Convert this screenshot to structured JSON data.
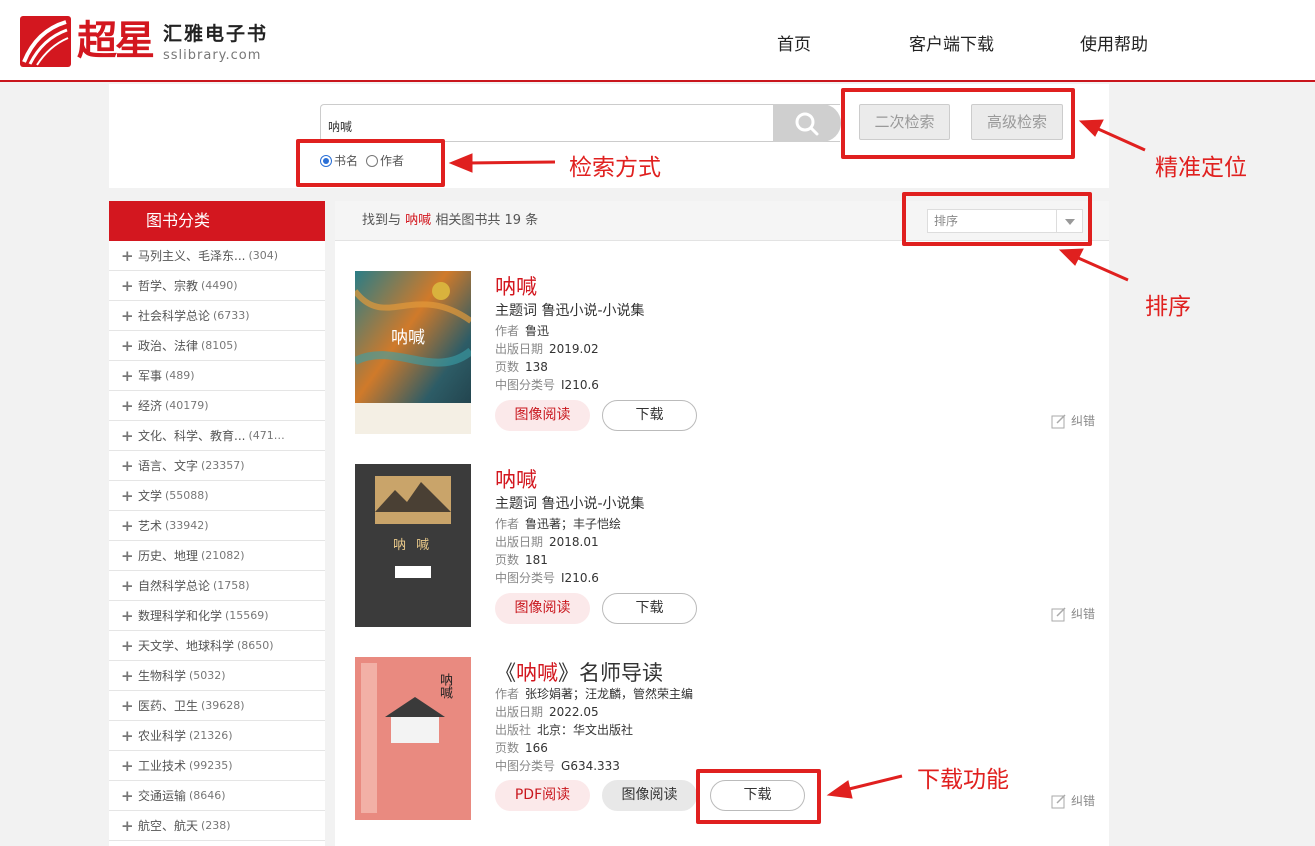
{
  "header": {
    "logo_cn": "超星",
    "logo_title": "汇雅电子书",
    "logo_sub": "sslibrary.com",
    "nav": [
      "首页",
      "客户端下载",
      "使用帮助"
    ]
  },
  "search": {
    "query": "呐喊",
    "secondary_search": "二次检索",
    "advanced_search": "高级检索",
    "modes": [
      {
        "label": "书名",
        "checked": true
      },
      {
        "label": "作者",
        "checked": false
      }
    ]
  },
  "annotations": {
    "search_mode": "检索方式",
    "precise": "精准定位",
    "sort": "排序",
    "download": "下载功能"
  },
  "sidebar": {
    "title": "图书分类",
    "categories": [
      {
        "name": "马列主义、毛泽东...",
        "count": "(304)"
      },
      {
        "name": "哲学、宗教",
        "count": "(4490)"
      },
      {
        "name": "社会科学总论",
        "count": "(6733)"
      },
      {
        "name": "政治、法律",
        "count": "(8105)"
      },
      {
        "name": "军事",
        "count": "(489)"
      },
      {
        "name": "经济",
        "count": "(40179)"
      },
      {
        "name": "文化、科学、教育...",
        "count": "(471…"
      },
      {
        "name": "语言、文字",
        "count": "(23357)"
      },
      {
        "name": "文学",
        "count": "(55088)"
      },
      {
        "name": "艺术",
        "count": "(33942)"
      },
      {
        "name": "历史、地理",
        "count": "(21082)"
      },
      {
        "name": "自然科学总论",
        "count": "(1758)"
      },
      {
        "name": "数理科学和化学",
        "count": "(15569)"
      },
      {
        "name": "天文学、地球科学",
        "count": "(8650)"
      },
      {
        "name": "生物科学",
        "count": "(5032)"
      },
      {
        "name": "医药、卫生",
        "count": "(39628)"
      },
      {
        "name": "农业科学",
        "count": "(21326)"
      },
      {
        "name": "工业技术",
        "count": "(99235)"
      },
      {
        "name": "交通运输",
        "count": "(8646)"
      },
      {
        "name": "航空、航天",
        "count": "(238)"
      }
    ]
  },
  "results": {
    "prefix": "找到与",
    "keyword": "呐喊",
    "suffix": "相关图书共 19 条",
    "sort_placeholder": "排序",
    "fix_label": "纠错",
    "books": [
      {
        "title": "呐喊",
        "subject_label": "主题词",
        "subject": "鲁迅小说-小说集",
        "author_label": "作者",
        "author": "鲁迅",
        "date_label": "出版日期",
        "date": "2019.02",
        "pages_label": "页数",
        "pages": "138",
        "clc_label": "中图分类号",
        "clc": "I210.6",
        "read_btn": "图像阅读",
        "dl_btn": "下载",
        "cover_text": "呐喊"
      },
      {
        "title": "呐喊",
        "subject_label": "主题词",
        "subject": "鲁迅小说-小说集",
        "author_label": "作者",
        "author": "鲁迅著；丰子恺绘",
        "date_label": "出版日期",
        "date": "2018.01",
        "pages_label": "页数",
        "pages": "181",
        "clc_label": "中图分类号",
        "clc": "I210.6",
        "read_btn": "图像阅读",
        "dl_btn": "下载",
        "cover_text": "呐 喊"
      },
      {
        "title_open": "《",
        "title_kw": "呐喊",
        "title_rest": "》名师导读",
        "author_label": "作者",
        "author": "张珍娟著；汪龙麟，管然荣主编",
        "date_label": "出版日期",
        "date": "2022.05",
        "pub_label": "出版社",
        "pub": "北京：华文出版社",
        "pages_label": "页数",
        "pages": "166",
        "clc_label": "中图分类号",
        "clc": "G634.333",
        "pdf_btn": "PDF阅读",
        "read_btn": "图像阅读",
        "dl_btn": "下载",
        "cover_text": "呐喊"
      }
    ]
  },
  "colors": {
    "brand": "#d3171f",
    "annotation": "#e0201f"
  }
}
